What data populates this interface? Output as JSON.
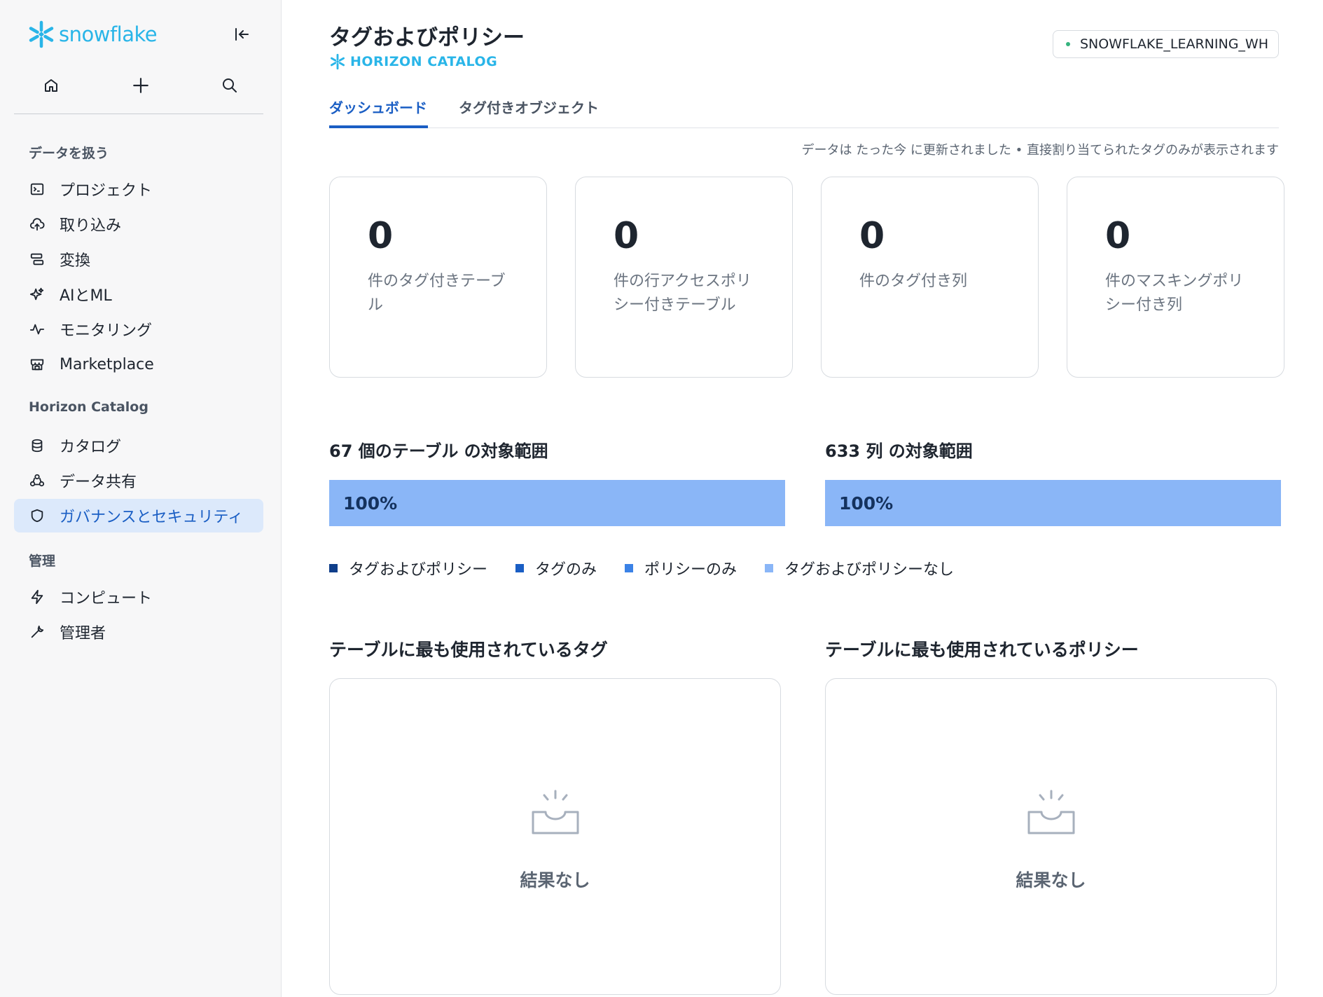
{
  "sidebar": {
    "logo_text": "snowflake",
    "sections": {
      "data": "データを扱う",
      "horizon": "Horizon Catalog",
      "admin": "管理"
    },
    "items": [
      {
        "label": "プロジェクト",
        "icon": "terminal-icon"
      },
      {
        "label": "取り込み",
        "icon": "cloud-upload-icon"
      },
      {
        "label": "変換",
        "icon": "transform-icon"
      },
      {
        "label": "AIとML",
        "icon": "sparkle-icon"
      },
      {
        "label": "モニタリング",
        "icon": "activity-icon"
      },
      {
        "label": "Marketplace",
        "icon": "store-icon"
      },
      {
        "label": "カタログ",
        "icon": "database-icon"
      },
      {
        "label": "データ共有",
        "icon": "share-icon"
      },
      {
        "label": "ガバナンスとセキュリティ",
        "icon": "shield-icon"
      },
      {
        "label": "コンピュート",
        "icon": "bolt-icon"
      },
      {
        "label": "管理者",
        "icon": "wrench-icon"
      }
    ]
  },
  "header": {
    "title": "タグおよびポリシー",
    "subtitle": "HORIZON CATALOG",
    "warehouse": "SNOWFLAKE_LEARNING_WH"
  },
  "tabs": [
    {
      "label": "ダッシュボード"
    },
    {
      "label": "タグ付きオブジェクト"
    }
  ],
  "updated_text": "データは たった今 に更新されました • 直接割り当てられたタグのみが表示されます",
  "cards": [
    {
      "value": "0",
      "label": "件のタグ付きテーブル"
    },
    {
      "value": "0",
      "label": "件の行アクセスポリシー付きテーブル"
    },
    {
      "value": "0",
      "label": "件のタグ付き列"
    },
    {
      "value": "0",
      "label": "件のマスキングポリシー付き列"
    }
  ],
  "coverage": [
    {
      "title": "67 個のテーブル の対象範囲",
      "percent_label": "100%",
      "fill_fraction": 1.0
    },
    {
      "title": "633 列 の対象範囲",
      "percent_label": "100%",
      "fill_fraction": 1.0
    }
  ],
  "legend": [
    {
      "label": "タグおよびポリシー",
      "color": "#0f3e8a"
    },
    {
      "label": "タグのみ",
      "color": "#1a5ec4"
    },
    {
      "label": "ポリシーのみ",
      "color": "#3b82e6"
    },
    {
      "label": "タグおよびポリシーなし",
      "color": "#8ab6f7"
    }
  ],
  "sections": {
    "tags_title": "テーブルに最も使用されているタグ",
    "policies_title": "テーブルに最も使用されているポリシー",
    "empty_text": "結果なし"
  },
  "colors": {
    "accent": "#1a5ec4",
    "brand": "#29b5e8",
    "bar_fill": "#8ab6f7"
  }
}
